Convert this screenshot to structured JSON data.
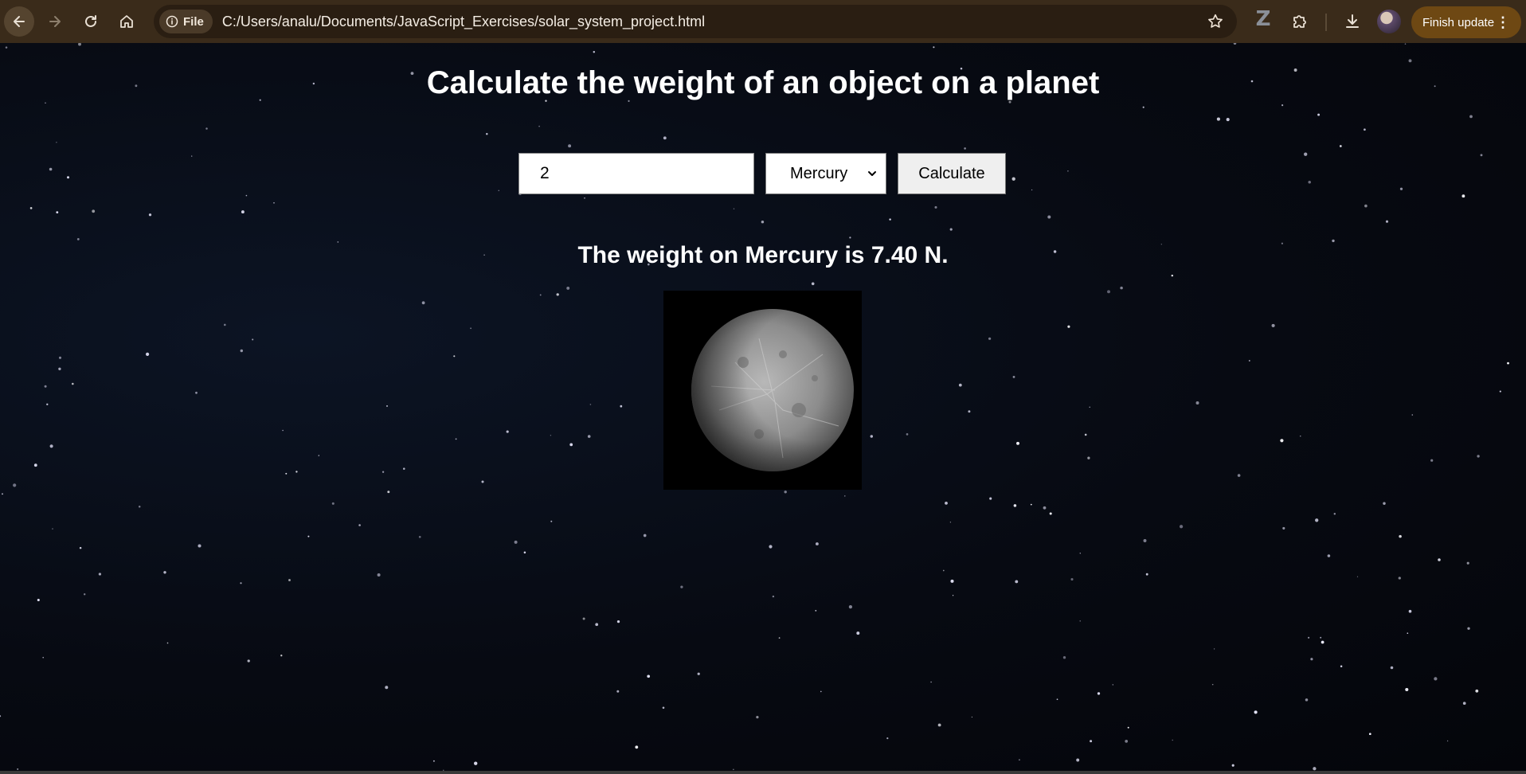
{
  "browser": {
    "chip_label": "File",
    "url": "C:/Users/analu/Documents/JavaScript_Exercises/solar_system_project.html",
    "update_label": "Finish update",
    "update_menu": "⋮",
    "z_label": "Z"
  },
  "page": {
    "title": "Calculate the weight of an object on a planet",
    "mass_value": "2",
    "planet_selected": "Mercury",
    "calculate_label": "Calculate",
    "result_text": "The weight on Mercury is 7.40 N."
  },
  "colors": {
    "toolbar": "#3a2b1a",
    "update_button": "#6e4813",
    "page_background": "#06070c"
  }
}
